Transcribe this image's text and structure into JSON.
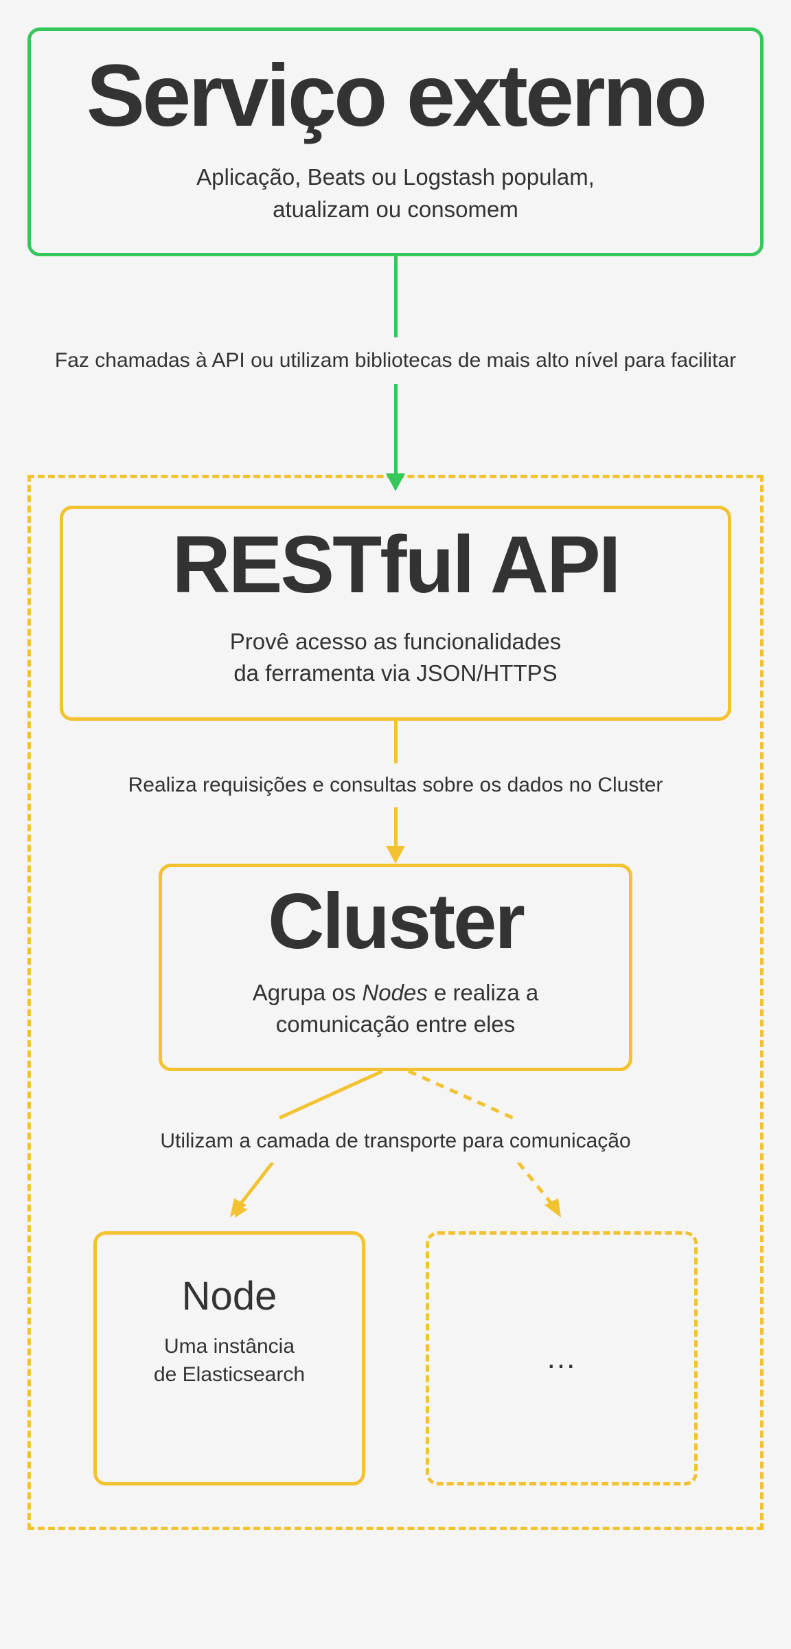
{
  "external": {
    "title": "Serviço externo",
    "subtitle1": "Aplicação, Beats ou Logstash populam,",
    "subtitle2": "atualizam ou consomem"
  },
  "edge1": "Faz chamadas à API ou utilizam bibliotecas de mais alto nível para facilitar",
  "api": {
    "title": "RESTful API",
    "subtitle1": "Provê acesso as funcionalidades",
    "subtitle2": "da ferramenta via JSON/HTTPS"
  },
  "edge2": "Realiza requisições e consultas sobre os dados no Cluster",
  "cluster": {
    "title": "Cluster",
    "sub_prefix": "Agrupa os ",
    "sub_em": "Nodes",
    "sub_suffix": " e realiza a",
    "subtitle2": "comunicação entre eles"
  },
  "edge3": "Utilizam a camada de transporte para comunicação",
  "node": {
    "title": "Node",
    "subtitle1": "Uma instância",
    "subtitle2": "de Elasticsearch"
  },
  "placeholder": "..."
}
